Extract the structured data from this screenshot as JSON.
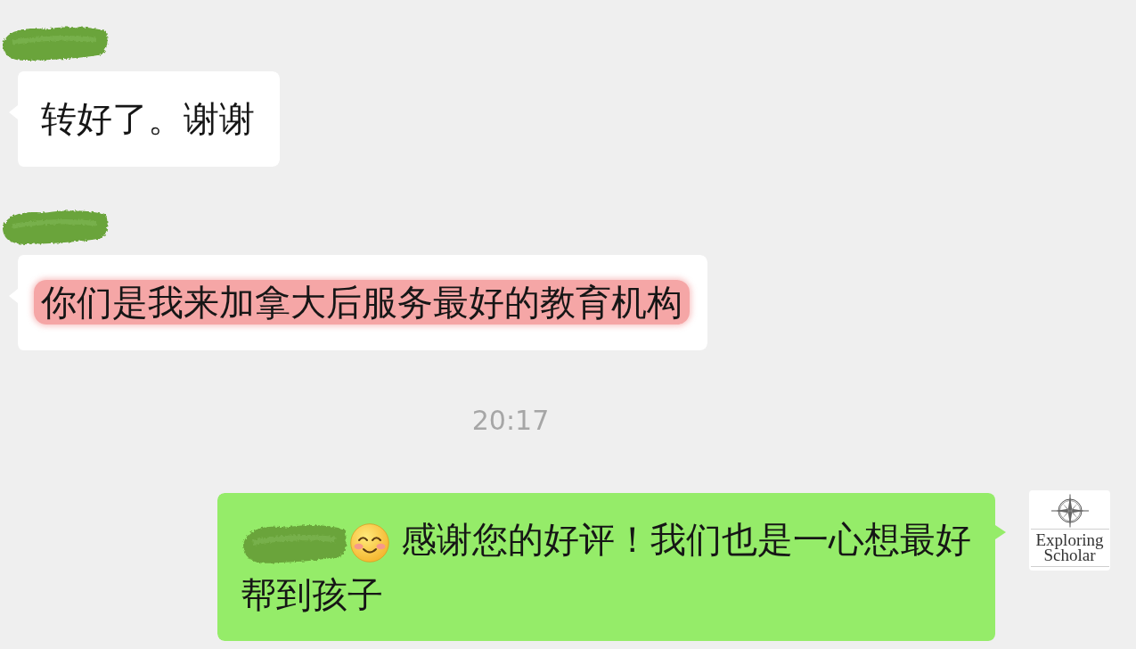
{
  "chat": [
    {
      "kind": "incoming",
      "sender_redacted": true,
      "lines": [
        [
          {
            "kind": "text",
            "text": "转好了。谢谢",
            "highlighted": false
          }
        ]
      ]
    },
    {
      "kind": "incoming",
      "sender_redacted": true,
      "lines": [
        [
          {
            "kind": "text",
            "text": "你们是我来加拿大后服务最好的教育机构",
            "highlighted": true
          }
        ]
      ]
    },
    {
      "kind": "time",
      "text": "20:17"
    },
    {
      "kind": "outgoing",
      "avatar": {
        "logo_text": "Exploring Scholar"
      },
      "lines": [
        [
          {
            "kind": "redaction"
          },
          {
            "kind": "emoji"
          },
          {
            "kind": "text",
            "text": "感谢您的好评！我们也是一心想最好",
            "highlighted": false
          }
        ],
        [
          {
            "kind": "text",
            "text": "帮到孩子",
            "highlighted": false
          }
        ]
      ]
    }
  ]
}
